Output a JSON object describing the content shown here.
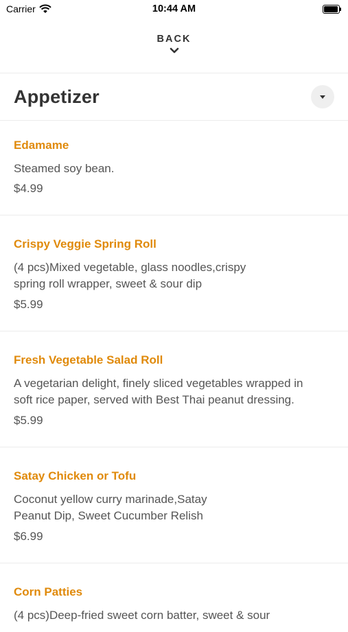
{
  "status_bar": {
    "carrier": "Carrier",
    "time": "10:44 AM"
  },
  "nav": {
    "back_label": "BACK"
  },
  "section": {
    "title": "Appetizer"
  },
  "menu_items": [
    {
      "name": "Edamame",
      "description": "Steamed soy bean.",
      "price": "$4.99"
    },
    {
      "name": "Crispy Veggie Spring Roll",
      "description": "(4 pcs)Mixed vegetable, glass noodles,crispy\nspring roll wrapper, sweet & sour dip",
      "price": "$5.99"
    },
    {
      "name": "Fresh Vegetable Salad Roll",
      "description": "A vegetarian delight, finely sliced vegetables wrapped in\nsoft rice paper, served with Best Thai peanut dressing.",
      "price": "$5.99"
    },
    {
      "name": "Satay Chicken or Tofu",
      "description": "Coconut yellow curry marinade,Satay\nPeanut Dip, Sweet Cucumber Relish",
      "price": "$6.99"
    },
    {
      "name": "Corn Patties",
      "description": "(4 pcs)Deep-fried sweet corn batter, sweet & sour",
      "price": ""
    }
  ],
  "colors": {
    "item_name": "#e08a0b",
    "text": "#555555",
    "divider": "#ececec"
  }
}
